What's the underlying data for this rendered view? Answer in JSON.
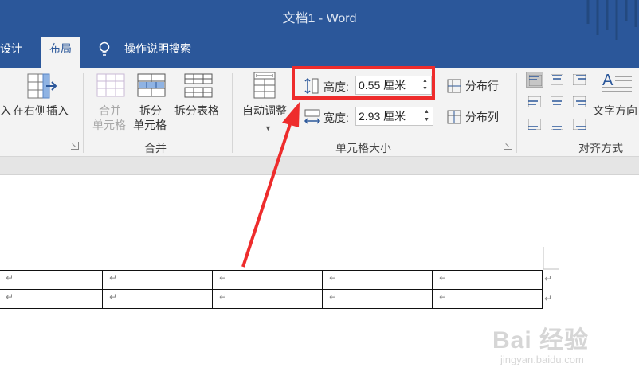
{
  "window": {
    "title": "文档1  -  Word"
  },
  "tabs": {
    "design": "表设计",
    "layout": "布局",
    "search": "操作说明搜索"
  },
  "ribbon": {
    "insert_left": "入",
    "insert_right": "在右侧插入",
    "merge_cells_1": "合并",
    "merge_cells_2": "单元格",
    "split_cells_1": "拆分",
    "split_cells_2": "单元格",
    "split_table": "拆分表格",
    "group_merge": "合并",
    "autofit": "自动调整",
    "height_label": "高度:",
    "height_value": "0.55 厘米",
    "width_label": "宽度:",
    "width_value": "2.93 厘米",
    "distribute_rows": "分布行",
    "distribute_cols": "分布列",
    "group_cellsize": "单元格大小",
    "text_direction": "文字方向",
    "group_align": "对齐方式"
  },
  "document": {
    "mark": "↵",
    "rows": [
      [
        "↵",
        "↵",
        "↵",
        "↵",
        "↵"
      ],
      [
        "↵",
        "↵",
        "↵",
        "↵",
        "↵"
      ]
    ]
  },
  "watermark": {
    "text": "Bai 经验",
    "url": "jingyan.baidu.com"
  },
  "colors": {
    "title_bar": "#2b579a",
    "highlight": "#ee2c2c",
    "ribbon": "#f3f3f3"
  }
}
